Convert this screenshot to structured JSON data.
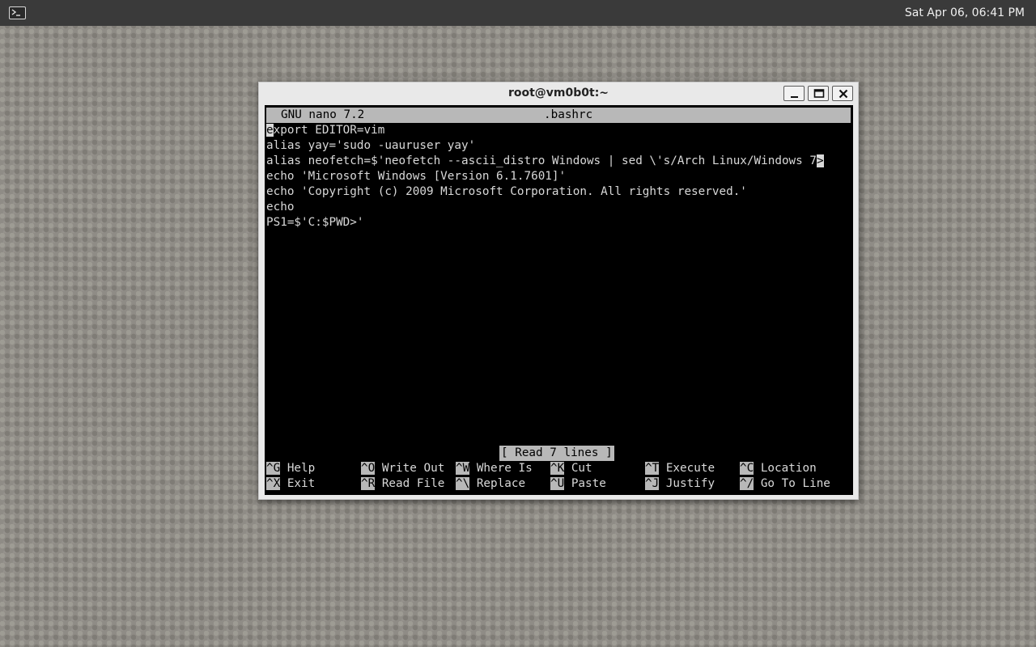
{
  "panel": {
    "clock": "Sat Apr 06, 06:41 PM",
    "launcher_icon": "terminal-icon"
  },
  "window": {
    "title": "root@vm0b0t:~",
    "buttons": [
      "minimize-icon",
      "maximize-icon",
      "close-icon"
    ]
  },
  "nano": {
    "version": "GNU nano 7.2",
    "filename": ".bashrc",
    "lines": [
      {
        "cursor_char": "e",
        "rest": "xport EDITOR=vim"
      },
      {
        "text": "alias yay='sudo -uauruser yay'"
      },
      {
        "text": "alias neofetch=$'neofetch --ascii_distro Windows | sed \\'s/Arch Linux/Windows 7",
        "overflow": ">"
      },
      {
        "text": "echo 'Microsoft Windows [Version 6.1.7601]'"
      },
      {
        "text": "echo 'Copyright (c) 2009 Microsoft Corporation. All rights reserved.'"
      },
      {
        "text": "echo"
      },
      {
        "text": "PS1=$'C:$PWD>'"
      }
    ],
    "status": "[ Read 7 lines ]",
    "shortcuts": [
      {
        "key": "^G",
        "label": "Help"
      },
      {
        "key": "^O",
        "label": "Write Out"
      },
      {
        "key": "^W",
        "label": "Where Is"
      },
      {
        "key": "^K",
        "label": "Cut"
      },
      {
        "key": "^T",
        "label": "Execute"
      },
      {
        "key": "^C",
        "label": "Location"
      },
      {
        "key": "^X",
        "label": "Exit"
      },
      {
        "key": "^R",
        "label": "Read File"
      },
      {
        "key": "^\\",
        "label": "Replace"
      },
      {
        "key": "^U",
        "label": "Paste"
      },
      {
        "key": "^J",
        "label": "Justify"
      },
      {
        "key": "^/",
        "label": "Go To Line"
      }
    ]
  },
  "colors": {
    "terminal_bg": "#000000",
    "terminal_fg": "#d8d8d8",
    "highlight": "#b8b8b8",
    "panel_bg": "#3a3a3a"
  }
}
